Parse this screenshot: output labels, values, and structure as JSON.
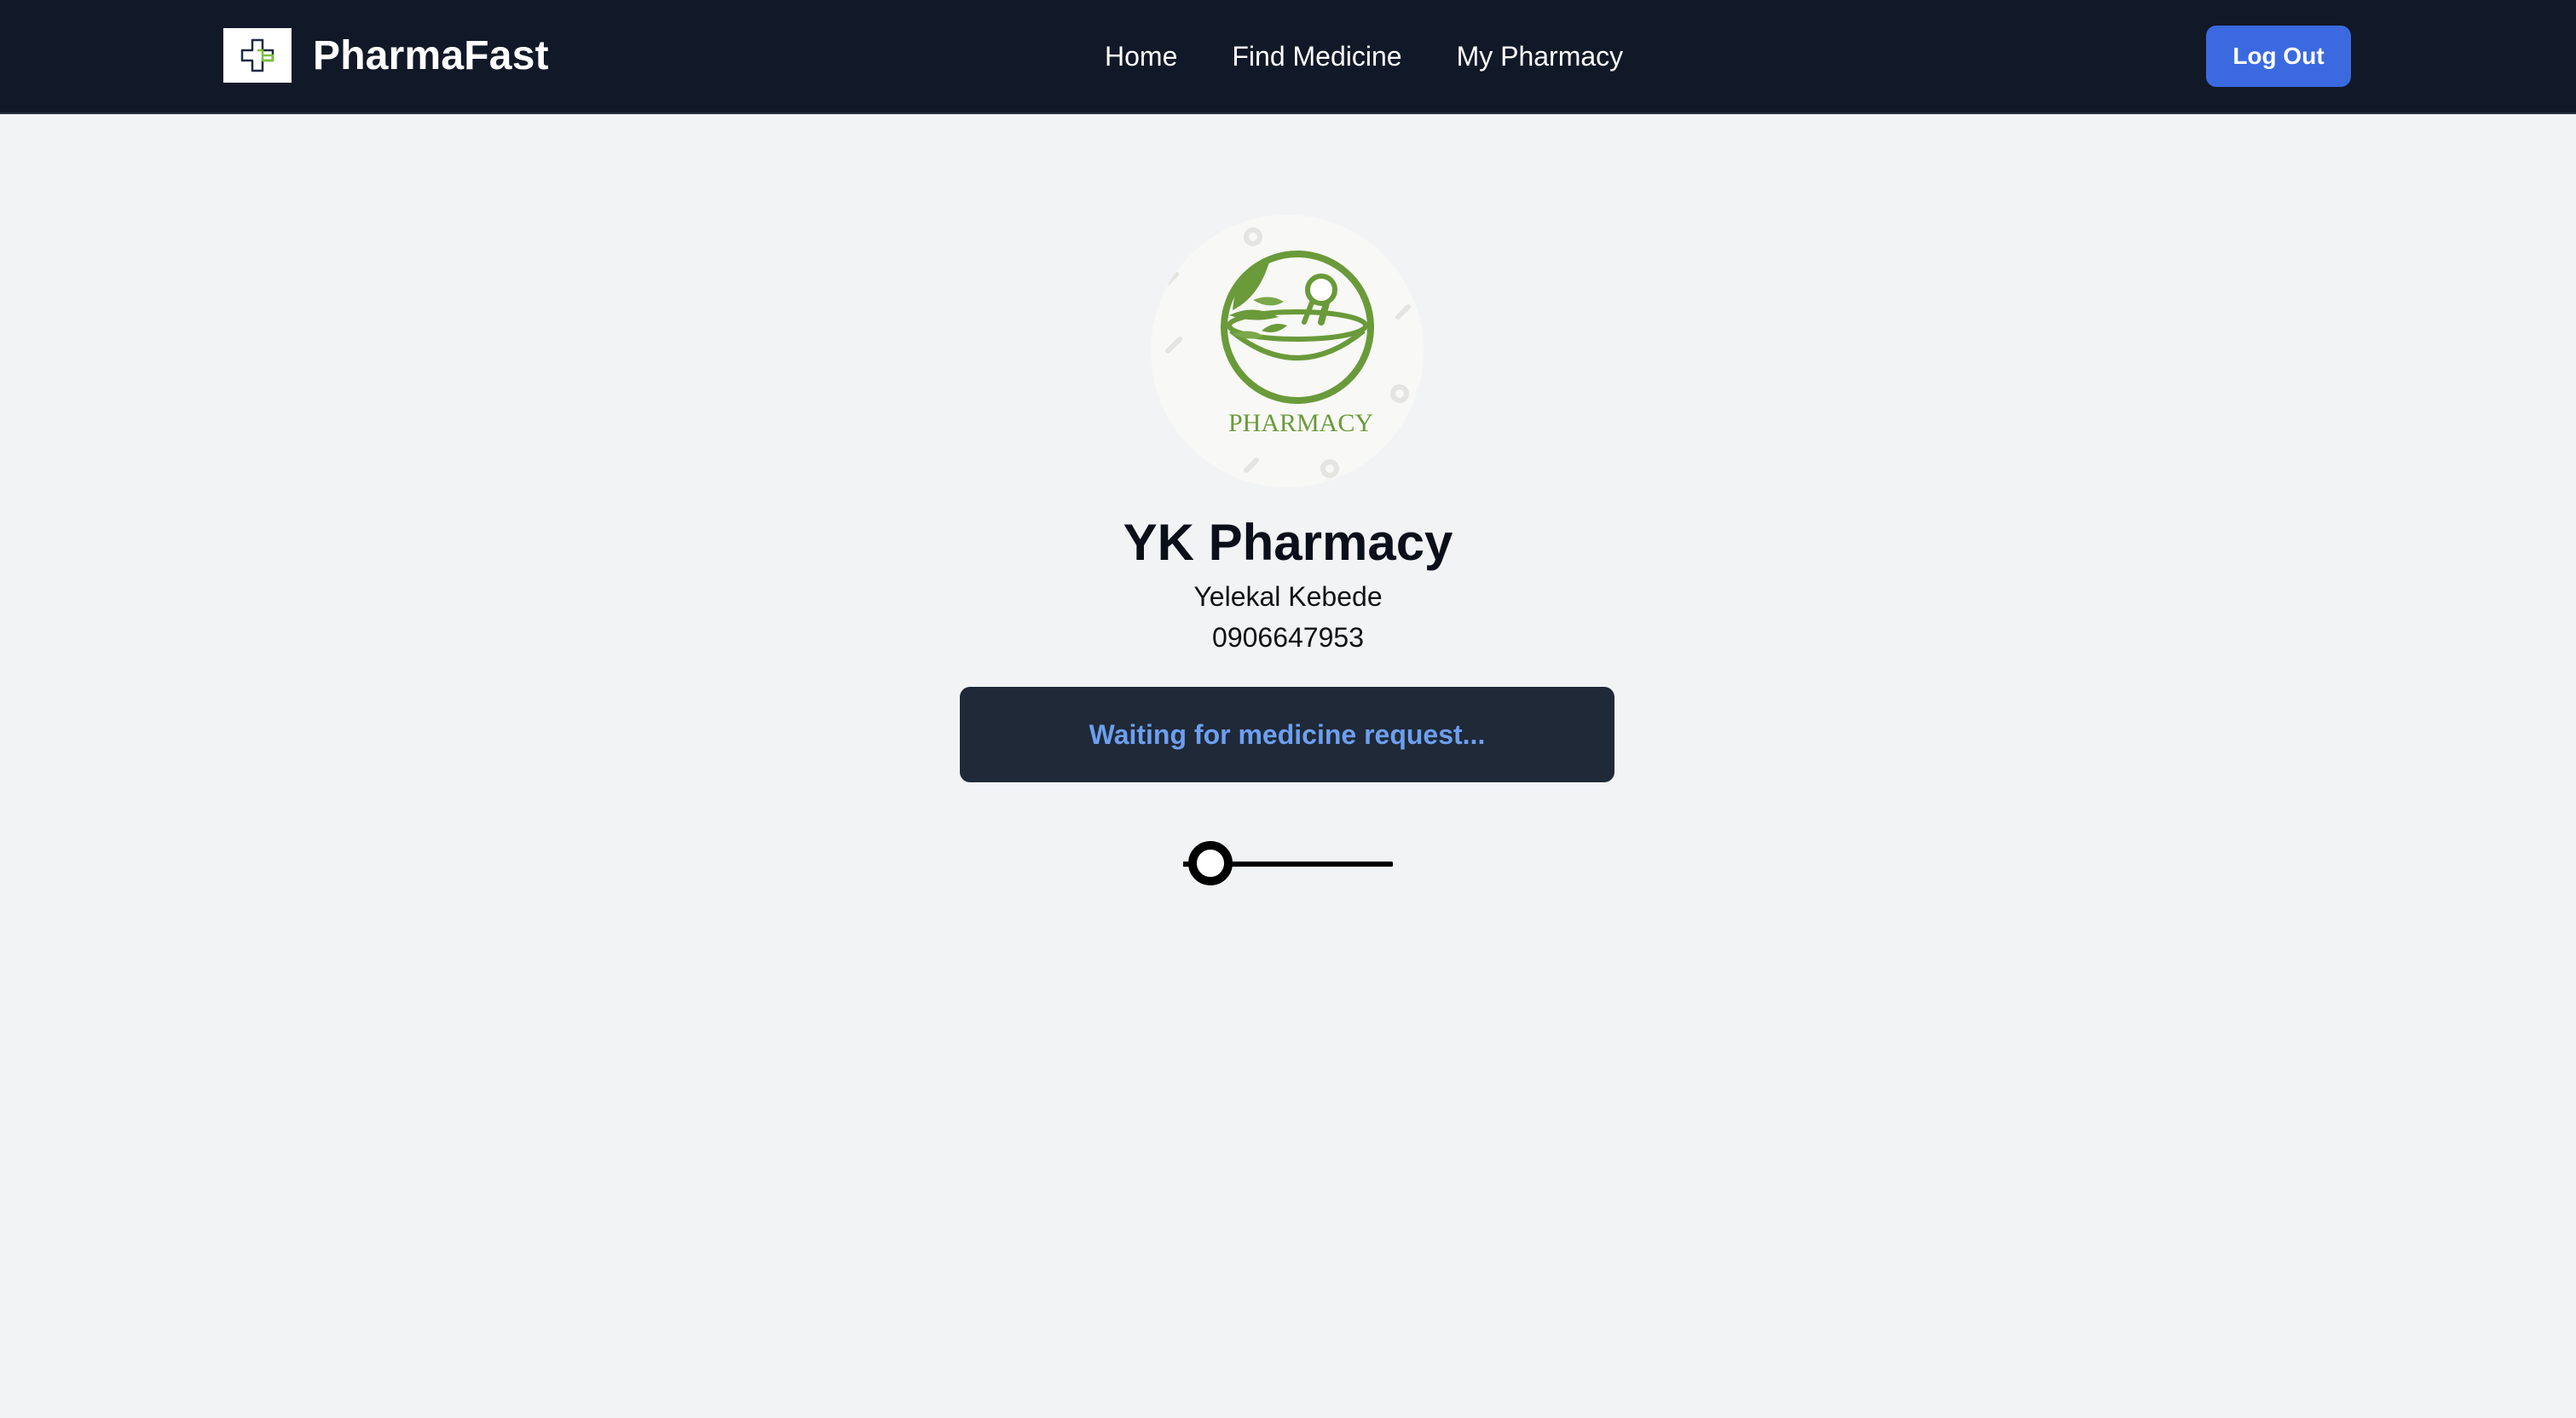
{
  "app": {
    "brand_name": "PharmaFast",
    "colors": {
      "navbar_bg": "#111827",
      "page_bg": "#f2f3f5",
      "accent": "#3b6ae0",
      "status_bg": "#1f2937",
      "status_text": "#6d9ff0",
      "logo_green": "#6a9a3a"
    }
  },
  "nav": {
    "links": [
      {
        "label": "Home"
      },
      {
        "label": "Find Medicine"
      },
      {
        "label": "My Pharmacy"
      }
    ],
    "logout_label": "Log Out"
  },
  "profile": {
    "avatar_caption": "PHARMACY",
    "pharmacy_name": "YK Pharmacy",
    "owner_name": "Yelekal Kebede",
    "phone": "0906647953"
  },
  "status": {
    "message": "Waiting for medicine request..."
  },
  "icons": {
    "brand": "medical-cross-icon",
    "avatar": "mortar-pestle-logo",
    "loader": "loading-spinner-icon"
  }
}
